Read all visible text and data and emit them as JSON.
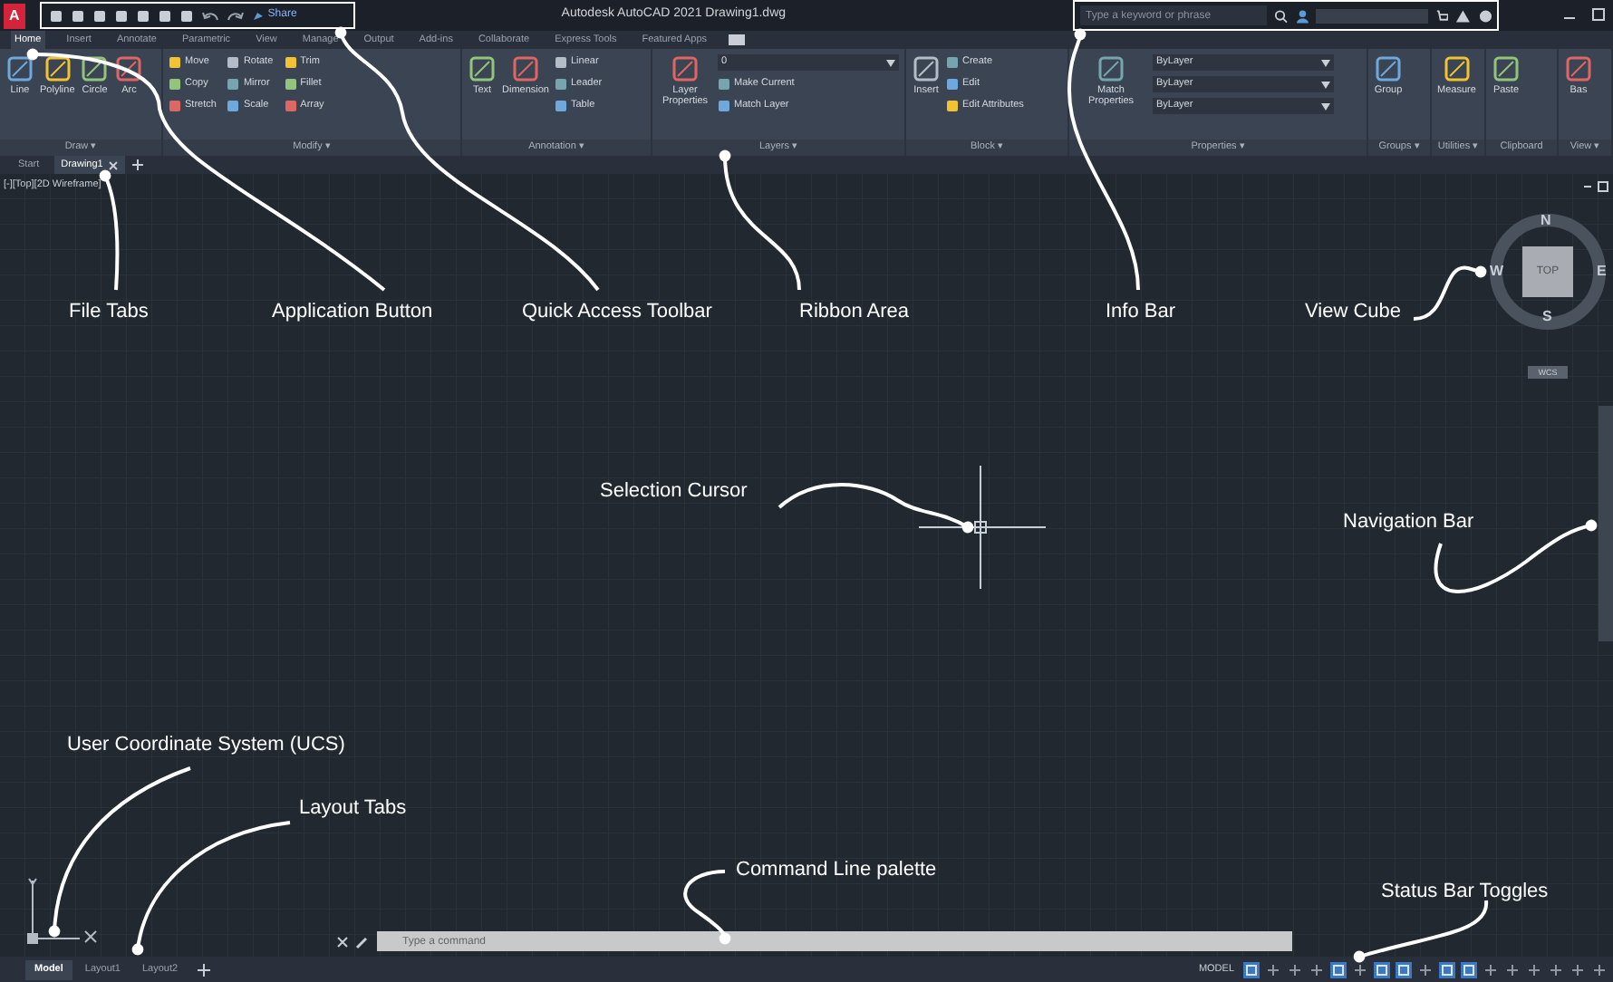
{
  "title_bar": {
    "app_button": "A",
    "quick_access": {
      "share": "Share"
    },
    "title": "Autodesk AutoCAD 2021   Drawing1.dwg",
    "search": {
      "placeholder": "Type a keyword or phrase"
    }
  },
  "ribbon": {
    "tabs": [
      {
        "label": "Home",
        "selected": true
      },
      {
        "label": "Insert",
        "selected": false
      },
      {
        "label": "Annotate",
        "selected": false
      },
      {
        "label": "Parametric",
        "selected": false
      },
      {
        "label": "View",
        "selected": false
      },
      {
        "label": "Manage",
        "selected": false
      },
      {
        "label": "Output",
        "selected": false
      },
      {
        "label": "Add-ins",
        "selected": false
      },
      {
        "label": "Collaborate",
        "selected": false
      },
      {
        "label": "Express Tools",
        "selected": false
      },
      {
        "label": "Featured Apps",
        "selected": false
      }
    ],
    "panels": [
      {
        "title": "Draw ▾",
        "tools": [
          {
            "kind": "large",
            "label": "Line"
          },
          {
            "kind": "large",
            "label": "Polyline"
          },
          {
            "kind": "large",
            "label": "Circle"
          },
          {
            "kind": "large",
            "label": "Arc"
          }
        ]
      },
      {
        "title": "Modify ▾",
        "tools": [
          {
            "kind": "small",
            "label": "Move"
          },
          {
            "kind": "small",
            "label": "Copy"
          },
          {
            "kind": "small",
            "label": "Stretch"
          },
          {
            "kind": "small",
            "label": "Rotate"
          },
          {
            "kind": "small",
            "label": "Mirror"
          },
          {
            "kind": "small",
            "label": "Scale"
          },
          {
            "kind": "small",
            "label": "Trim"
          },
          {
            "kind": "small",
            "label": "Fillet"
          },
          {
            "kind": "small",
            "label": "Array"
          }
        ]
      },
      {
        "title": "Annotation ▾",
        "tools": [
          {
            "kind": "large",
            "label": "Text"
          },
          {
            "kind": "large",
            "label": "Dimension"
          },
          {
            "kind": "small",
            "label": "Linear"
          },
          {
            "kind": "small",
            "label": "Leader"
          },
          {
            "kind": "small",
            "label": "Table"
          }
        ]
      },
      {
        "title": "Layers ▾",
        "tools": [
          {
            "kind": "large",
            "label": "Layer Properties"
          },
          {
            "kind": "dropdown",
            "label": "0"
          },
          {
            "kind": "small",
            "label": "Make Current"
          },
          {
            "kind": "small",
            "label": "Match Layer"
          }
        ]
      },
      {
        "title": "Block ▾",
        "tools": [
          {
            "kind": "large",
            "label": "Insert"
          },
          {
            "kind": "small",
            "label": "Create"
          },
          {
            "kind": "small",
            "label": "Edit"
          },
          {
            "kind": "small",
            "label": "Edit Attributes"
          }
        ]
      },
      {
        "title": "Properties ▾",
        "tools": [
          {
            "kind": "large",
            "label": "Match Properties"
          },
          {
            "kind": "dropdown",
            "label": "ByLayer"
          },
          {
            "kind": "dropdown",
            "label": "ByLayer"
          },
          {
            "kind": "dropdown",
            "label": "ByLayer"
          }
        ]
      },
      {
        "title": "Groups ▾",
        "tools": [
          {
            "kind": "large",
            "label": "Group"
          }
        ]
      },
      {
        "title": "Utilities ▾",
        "tools": [
          {
            "kind": "large",
            "label": "Measure"
          }
        ]
      },
      {
        "title": "Clipboard",
        "tools": [
          {
            "kind": "large",
            "label": "Paste"
          }
        ]
      },
      {
        "title": "View ▾",
        "tools": [
          {
            "kind": "large",
            "label": "Bas"
          }
        ]
      }
    ]
  },
  "file_tabs": [
    {
      "label": "Start",
      "selected": false
    },
    {
      "label": "Drawing1",
      "selected": true
    }
  ],
  "viewport": {
    "label": "[-][Top][2D Wireframe]",
    "view_cube": {
      "face": "TOP",
      "north": "N",
      "east": "E",
      "south": "S",
      "west": "W",
      "coordinate_system": "WCS"
    }
  },
  "command_line": {
    "placeholder": "Type a command"
  },
  "layout_tabs": [
    {
      "label": "Model",
      "selected": true
    },
    {
      "label": "Layout1",
      "selected": false
    },
    {
      "label": "Layout2",
      "selected": false
    }
  ],
  "status_bar": {
    "space": "MODEL",
    "toggles": [
      {
        "on": true
      },
      {
        "on": false
      },
      {
        "on": false
      },
      {
        "on": false
      },
      {
        "on": true
      },
      {
        "on": false
      },
      {
        "on": true
      },
      {
        "on": true
      },
      {
        "on": false
      },
      {
        "on": true
      },
      {
        "on": true
      },
      {
        "on": false
      },
      {
        "on": false
      },
      {
        "on": false
      },
      {
        "on": false
      },
      {
        "on": false
      },
      {
        "on": false
      }
    ]
  },
  "annotations": [
    {
      "text": "File Tabs"
    },
    {
      "text": "Application Button"
    },
    {
      "text": "Quick Access Toolbar"
    },
    {
      "text": "Ribbon Area"
    },
    {
      "text": "Info Bar"
    },
    {
      "text": "View Cube"
    },
    {
      "text": "Selection Cursor"
    },
    {
      "text": "Navigation Bar"
    },
    {
      "text": "User Coordinate System (UCS)"
    },
    {
      "text": "Layout Tabs"
    },
    {
      "text": "Command Line palette"
    },
    {
      "text": "Status Bar Toggles"
    }
  ]
}
